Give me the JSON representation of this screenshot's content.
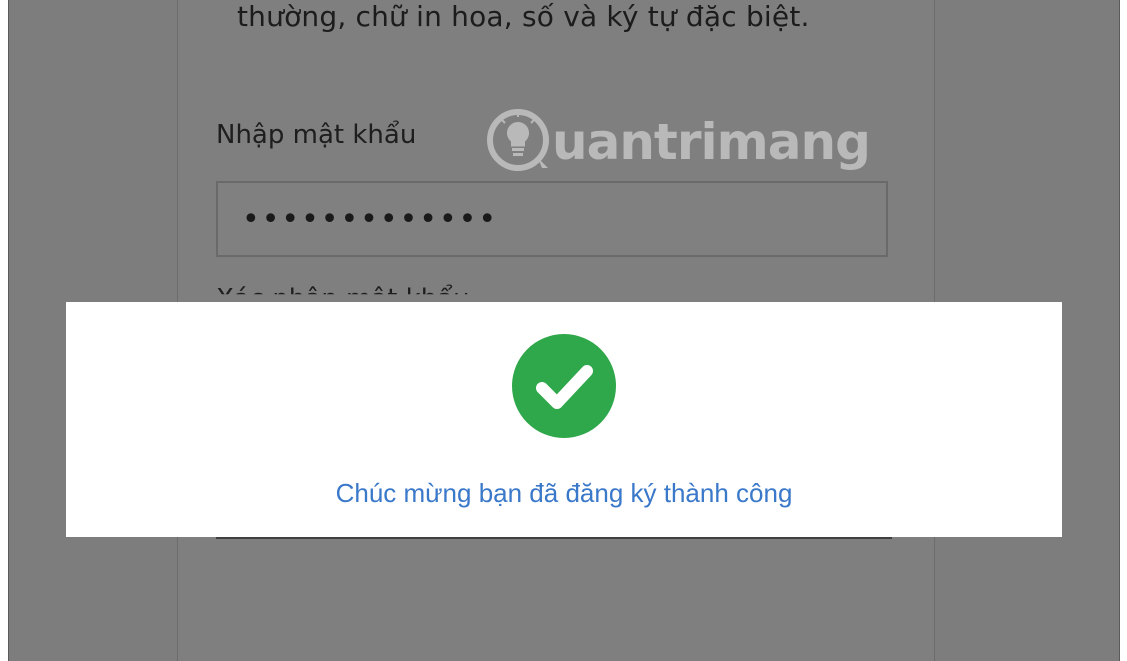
{
  "form": {
    "hint_text": "thường, chữ in hoa, số và ký tự đặc biệt.",
    "password_label": "Nhập mật khẩu",
    "password_value": "•••••••••••••",
    "confirm_label": "Xác nhận mật khẩu"
  },
  "watermark": {
    "text": "uantrimang",
    "icon": "lightbulb-icon"
  },
  "modal": {
    "icon": "checkmark-icon",
    "message": "Chúc mừng bạn đã đăng ký thành công"
  },
  "colors": {
    "overlay": "#7d7d7d",
    "success_green": "#2ea84a",
    "message_blue": "#3a78c9",
    "modal_bg": "#ffffff"
  }
}
